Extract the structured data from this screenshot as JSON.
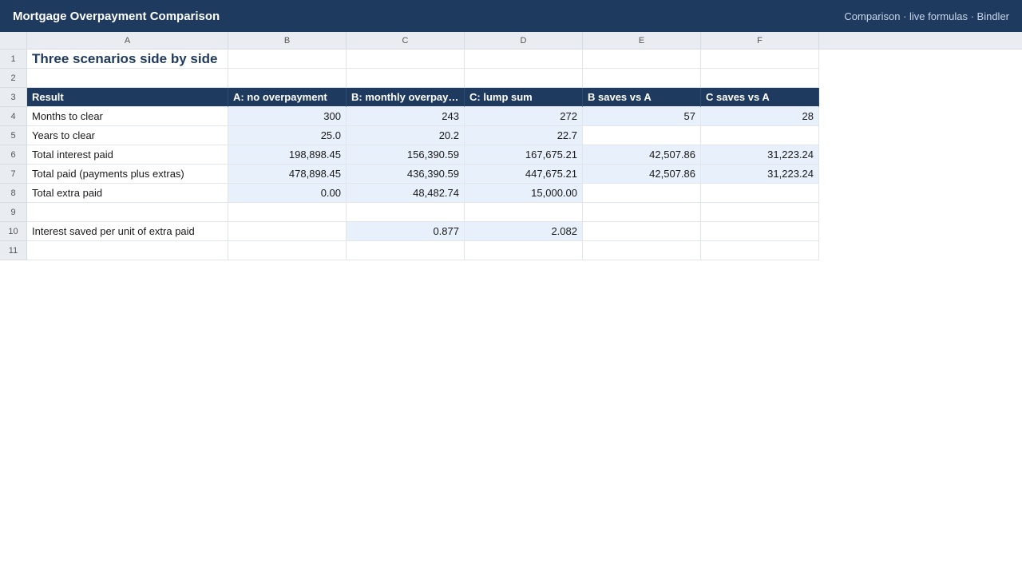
{
  "app": {
    "title": "Mortgage Overpayment Comparison",
    "status": "Comparison · live formulas · Bindler"
  },
  "colors": {
    "header_bg": "#1f3a5f",
    "calc_cell": "#e8f0fb"
  },
  "columns": [
    "A",
    "B",
    "C",
    "D",
    "E",
    "F"
  ],
  "rows": [
    "1",
    "2",
    "3",
    "4",
    "5",
    "6",
    "7",
    "8",
    "9",
    "10",
    "11"
  ],
  "sheet": {
    "title": "Three scenarios side by side",
    "headers": [
      "Result",
      "A: no overpayment",
      "B: monthly overpay…",
      "C: lump sum",
      "B saves vs A",
      "C saves vs A"
    ],
    "r4": [
      "Months to clear",
      "300",
      "243",
      "272",
      "57",
      "28"
    ],
    "r5": [
      "Years to clear",
      "25.0",
      "20.2",
      "22.7",
      "",
      ""
    ],
    "r6": [
      "Total interest paid",
      "198,898.45",
      "156,390.59",
      "167,675.21",
      "42,507.86",
      "31,223.24"
    ],
    "r7": [
      "Total paid (payments plus extras)",
      "478,898.45",
      "436,390.59",
      "447,675.21",
      "42,507.86",
      "31,223.24"
    ],
    "r8": [
      "Total extra paid",
      "0.00",
      "48,482.74",
      "15,000.00",
      "",
      ""
    ],
    "r10": [
      "Interest saved per unit of extra paid",
      "",
      "0.877",
      "2.082",
      "",
      ""
    ]
  }
}
